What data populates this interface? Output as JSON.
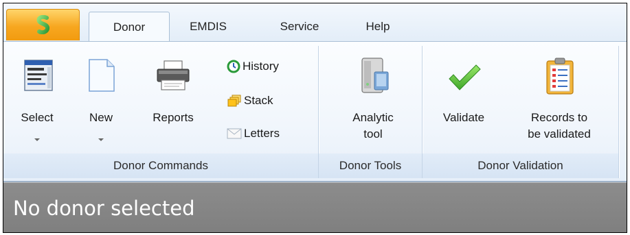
{
  "tabs": [
    {
      "label": "Donor",
      "active": true
    },
    {
      "label": "EMDIS",
      "active": false
    },
    {
      "label": "Service",
      "active": false
    },
    {
      "label": "Help",
      "active": false
    }
  ],
  "groups": {
    "donor_commands": {
      "title": "Donor Commands",
      "select": "Select",
      "new": "New",
      "reports": "Reports",
      "history": "History",
      "stack": "Stack",
      "letters": "Letters"
    },
    "donor_tools": {
      "title": "Donor Tools",
      "analytic_line1": "Analytic",
      "analytic_line2": "tool"
    },
    "donor_validation": {
      "title": "Donor Validation",
      "validate": "Validate",
      "records_line1": "Records to",
      "records_line2": "be validated"
    }
  },
  "status": {
    "message": "No donor selected"
  },
  "colors": {
    "app_button": "#f7a720",
    "ribbon_bg": "#f1f6fc",
    "status_banner": "#858585",
    "validate_check": "#5cc23a"
  },
  "icons": {
    "app_logo": "app-logo-icon",
    "select": "select-form-icon",
    "new": "new-document-icon",
    "reports": "printer-icon",
    "history": "history-clock-icon",
    "stack": "stack-icon",
    "letters": "envelope-icon",
    "analytic": "server-icon",
    "validate": "checkmark-icon",
    "records": "clipboard-checklist-icon"
  }
}
